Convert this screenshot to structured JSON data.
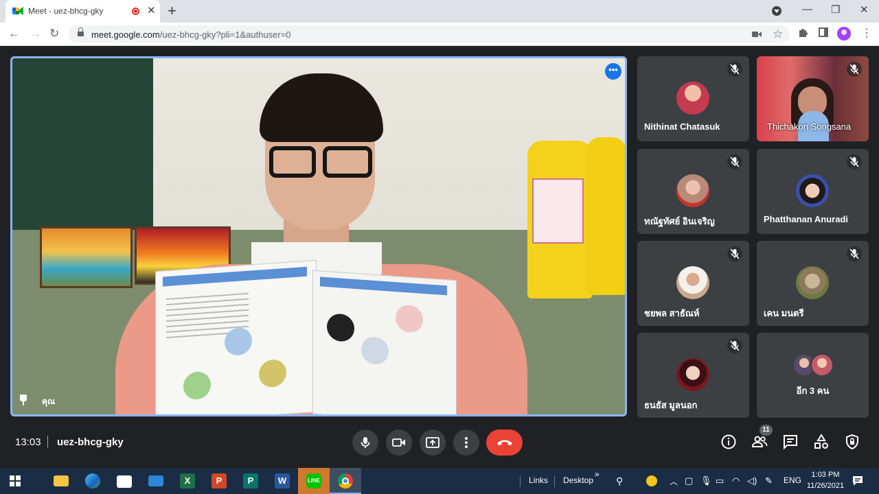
{
  "browser": {
    "tab_title": "Meet - uez-bhcg-gky",
    "url_domain": "meet.google.com",
    "url_path": "/uez-bhcg-gky?pli=1&authuser=0"
  },
  "main_video": {
    "self_label": "คุณ"
  },
  "participants": [
    {
      "name": "Nithinat Chatasuk",
      "muted": true,
      "avatar_color": "#c43a4f"
    },
    {
      "name": "Thichakon Songsana",
      "muted": true,
      "video": true
    },
    {
      "name": "ทณัฐทัศย์ อินเจริญ",
      "muted": true,
      "avatar_color": "#b98a7a"
    },
    {
      "name": "Phatthanan Anuradi",
      "muted": true,
      "avatar_color": "#3a4fae"
    },
    {
      "name": "ชยพล สาธัณห์",
      "muted": true,
      "avatar_color": "#caa98e"
    },
    {
      "name": "เคน มนตรี",
      "muted": true,
      "avatar_color": "#6c7a3e"
    },
    {
      "name": "ธนธัส มูลนอก",
      "muted": true,
      "avatar_color": "#7a1820"
    }
  ],
  "more_tile": {
    "label": "อีก 3 คน"
  },
  "bottom_bar": {
    "time": "13:03",
    "meeting_code": "uez-bhcg-gky",
    "people_count": "11"
  },
  "taskbar": {
    "links_label": "Links",
    "desktop_label": "Desktop",
    "chevron": "»",
    "lang": "ENG",
    "clock_time": "1:03 PM",
    "clock_date": "11/26/2021"
  }
}
